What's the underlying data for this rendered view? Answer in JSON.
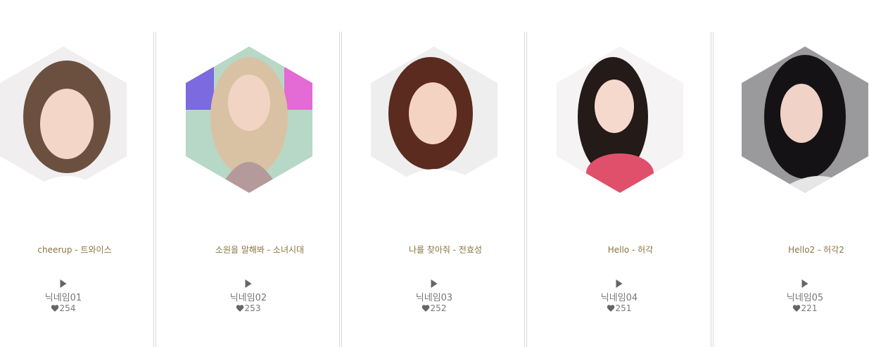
{
  "cards": [
    {
      "title": "cheerup - 트와이스",
      "nickname": "닉네임01",
      "likes": "254",
      "photo": {
        "bg": "#f1eef0",
        "hair": "#6b5040",
        "skin": "#f3d6c8",
        "cloth": "#ffffff"
      }
    },
    {
      "title": "소원을 말해봐 - 소녀시대",
      "nickname": "닉네임02",
      "likes": "253",
      "photo": {
        "bg": "#b7d8c6",
        "hair": "#d8c2a3",
        "skin": "#f2d4c4",
        "cloth": "#b49a9a"
      }
    },
    {
      "title": "나를 찾아줘 - 전효성",
      "nickname": "닉네임03",
      "likes": "252",
      "photo": {
        "bg": "#eeeeee",
        "hair": "#5a2b1e",
        "skin": "#f5d3c2",
        "cloth": "#ffffff"
      }
    },
    {
      "title": "Hello - 허각",
      "nickname": "닉네임04",
      "likes": "251",
      "photo": {
        "bg": "#f5f3f4",
        "hair": "#241a18",
        "skin": "#f6d9cd",
        "cloth": "#e0506a"
      }
    },
    {
      "title": "Hello2 - 허각2",
      "nickname": "닉네임05",
      "likes": "221",
      "photo": {
        "bg": "#9a9a9c",
        "hair": "#141214",
        "skin": "#f0d2c6",
        "cloth": "#e6e6e6"
      }
    }
  ],
  "colors": {
    "title_text": "#8a7440",
    "meta_text": "#777777",
    "icon": "#666666",
    "divider": "#d8d8d8"
  }
}
